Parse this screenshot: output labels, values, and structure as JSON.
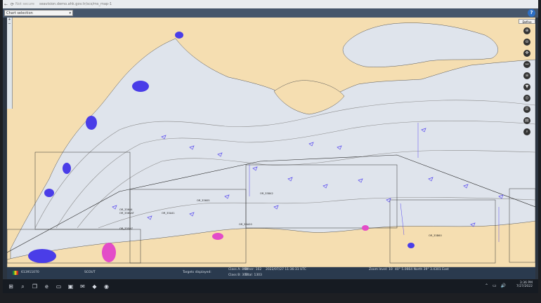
{
  "browser": {
    "security_label": "Not secure",
    "url": "seavision.demo.ahk.gov.tr/scs/ms_map-1"
  },
  "toolbar": {
    "chart_select": "Chart selection",
    "help_icon": "help-icon"
  },
  "tools": {
    "button_label": "Define",
    "icons": [
      "zoom-in-icon",
      "zoom-out-icon",
      "pan-icon",
      "measure-icon",
      "layers-icon",
      "filter-icon",
      "target-icon",
      "list-icon",
      "print-icon",
      "search-icon"
    ]
  },
  "map": {
    "area_labels": [
      "OR_33644",
      "OR_336SAT",
      "OR_33A41",
      "OR_33SAZ",
      "OR_33B42",
      "OR_33B60",
      "OR_33605",
      "OR_33A20"
    ],
    "colors": {
      "land": "#f5deb1",
      "sea": "#dfe4ec",
      "vessel": "#5a4cf0",
      "cluster": "#4a3de8",
      "highlight": "#e34cc8"
    }
  },
  "status": {
    "mmsi": "613911070",
    "name": "SCOUT",
    "targets_label": "Targets displayed:",
    "class_a": "Class A: 894",
    "class_b": "Class B: 307",
    "other": "Other: 102",
    "total": "Total: 1303",
    "timestamp": "2022/07/27 11:36:31 UTC",
    "zoom": "Zoom level: 10",
    "coords": "40° 5.0664 North   39° 3.4301 East"
  },
  "taskbar": {
    "time": "3:36 PM",
    "date": "7/27/2022"
  }
}
